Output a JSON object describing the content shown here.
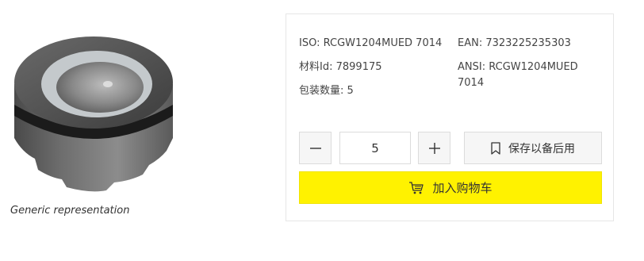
{
  "image": {
    "caption": "Generic representation",
    "icon": "carbide-insert-image"
  },
  "specs": {
    "iso_label": "ISO:",
    "iso_value": "RCGW1204MUED 7014",
    "ean_label": "EAN:",
    "ean_value": "7323225235303",
    "material_label": "材料Id:",
    "material_value": "7899175",
    "ansi_label": "ANSI:",
    "ansi_value_line1": "RCGW1204MUED",
    "ansi_value_line2": "7014",
    "pack_label": "包装数量:",
    "pack_value": "5"
  },
  "purchase": {
    "quantity": "5",
    "decrement_icon": "minus-icon",
    "increment_icon": "plus-icon",
    "save_label": "保存以备后用",
    "save_icon": "bookmark-icon",
    "cart_label": "加入购物车",
    "cart_icon": "cart-icon",
    "accent_color": "#fff200"
  }
}
